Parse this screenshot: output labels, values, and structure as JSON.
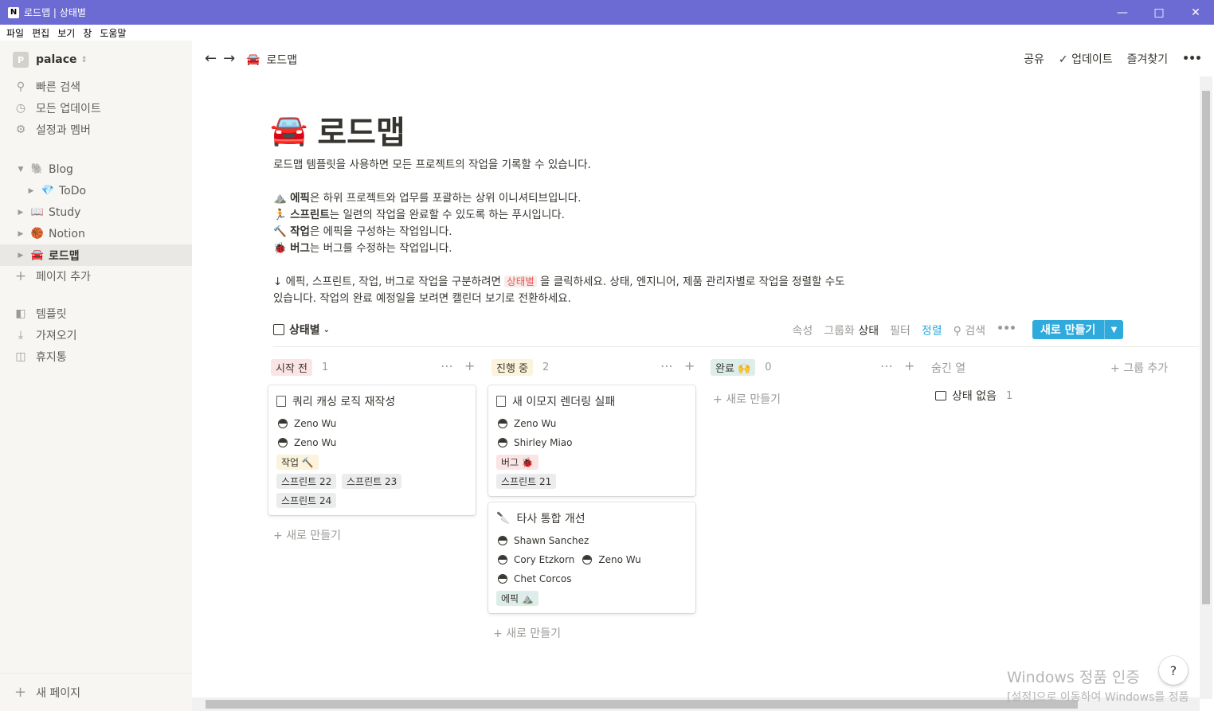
{
  "window": {
    "title": "로드맵 | 상태별",
    "app_icon": "N"
  },
  "menu": [
    "파일",
    "편집",
    "보기",
    "창",
    "도움말"
  ],
  "sidebar": {
    "workspace_initial": "P",
    "workspace_name": "palace",
    "top_items": [
      {
        "icon": "search-icon",
        "label": "빠른 검색"
      },
      {
        "icon": "clock-icon",
        "label": "모든 업데이트"
      },
      {
        "icon": "gear-icon",
        "label": "설정과 멤버"
      }
    ],
    "pages": [
      {
        "emoji": "🐘",
        "label": "Blog"
      },
      {
        "emoji": "💎",
        "label": "ToDo"
      },
      {
        "emoji": "📖",
        "label": "Study"
      },
      {
        "emoji": "🏀",
        "label": "Notion"
      },
      {
        "emoji": "🚘",
        "label": "로드맵"
      }
    ],
    "add_page": "페이지 추가",
    "bottom_items": [
      {
        "icon": "template-icon",
        "label": "템플릿"
      },
      {
        "icon": "download-icon",
        "label": "가져오기"
      },
      {
        "icon": "trash-icon",
        "label": "휴지통"
      }
    ],
    "new_page": "새 페이지"
  },
  "topbar": {
    "breadcrumb_emoji": "🚘",
    "breadcrumb": "로드맵",
    "share": "공유",
    "updates": "업데이트",
    "favorite": "즐겨찾기",
    "more": "•••"
  },
  "page": {
    "emoji": "🚘",
    "title": "로드맵",
    "intro": "로드맵 템플릿을 사용하면 모든 프로젝트의 작업을 기록할 수 있습니다.",
    "lines": [
      {
        "emoji": "⛰️",
        "bold": "에픽",
        "rest": "은 하위 프로젝트와 업무를 포괄하는 상위 이니셔티브입니다."
      },
      {
        "emoji": "🏃",
        "bold": "스프린트",
        "rest": "는 일련의 작업을 완료할 수 있도록 하는 푸시입니다."
      },
      {
        "emoji": "🔨",
        "bold": "작업",
        "rest": "은 에픽을 구성하는 작업입니다."
      },
      {
        "emoji": "🐞",
        "bold": "버그",
        "rest": "는 버그를 수정하는 작업입니다."
      }
    ],
    "para_prefix": "↓ 에픽, 스프린트, 작업, 버그로 작업을 구분하려면 ",
    "para_tag": "상태별",
    "para_suffix": " 을 클릭하세요. 상태, 엔지니어, 제품 관리자별로 작업을 정렬할 수도",
    "para_line2": "있습니다. 작업의 완료 예정일을 보려면 캘린더 보기로 전환하세요."
  },
  "db": {
    "view_name": "상태별",
    "properties": "속성",
    "group_prefix": "그룹화",
    "group_value": "상태",
    "filter": "필터",
    "sort": "정렬",
    "search": "검색",
    "more": "•••",
    "new_button": "새로 만들기",
    "add_new": "새로 만들기",
    "hidden_col": "숨긴 열",
    "add_group": "그룹 추가",
    "no_status": "상태 없음",
    "no_status_count": "1"
  },
  "columns": [
    {
      "name": "시작 전",
      "count": "1",
      "color": "#fbe4e4"
    },
    {
      "name": "진행 중",
      "count": "2",
      "color": "#fbf3db"
    },
    {
      "name": "완료 🙌",
      "count": "0",
      "color": "#ddedea"
    }
  ],
  "cards": [
    {
      "title": "쿼리 캐싱 로직 재작성",
      "people": [
        "Zeno Wu",
        "Zeno Wu"
      ],
      "type_tag": "작업 🔨",
      "sprints": [
        "스프린트 22",
        "스프린트 23",
        "스프린트 24"
      ]
    },
    {
      "title": "새 이모지 렌더링 실패",
      "people": [
        "Zeno Wu",
        "Shirley Miao"
      ],
      "type_tag": "버그 🐞",
      "sprints": [
        "스프린트 21"
      ]
    },
    {
      "title": "타사 통합 개선",
      "title_emoji": "🔪",
      "people": [
        "Shawn Sanchez",
        "Cory Etzkorn",
        "Zeno Wu",
        "Chet Corcos"
      ],
      "type_tag": "에픽 ⛰️"
    }
  ],
  "watermark": {
    "line1": "Windows 정품 인증",
    "line2": "[설정]으로 이동하여 Windows를 정품"
  },
  "help": "?"
}
